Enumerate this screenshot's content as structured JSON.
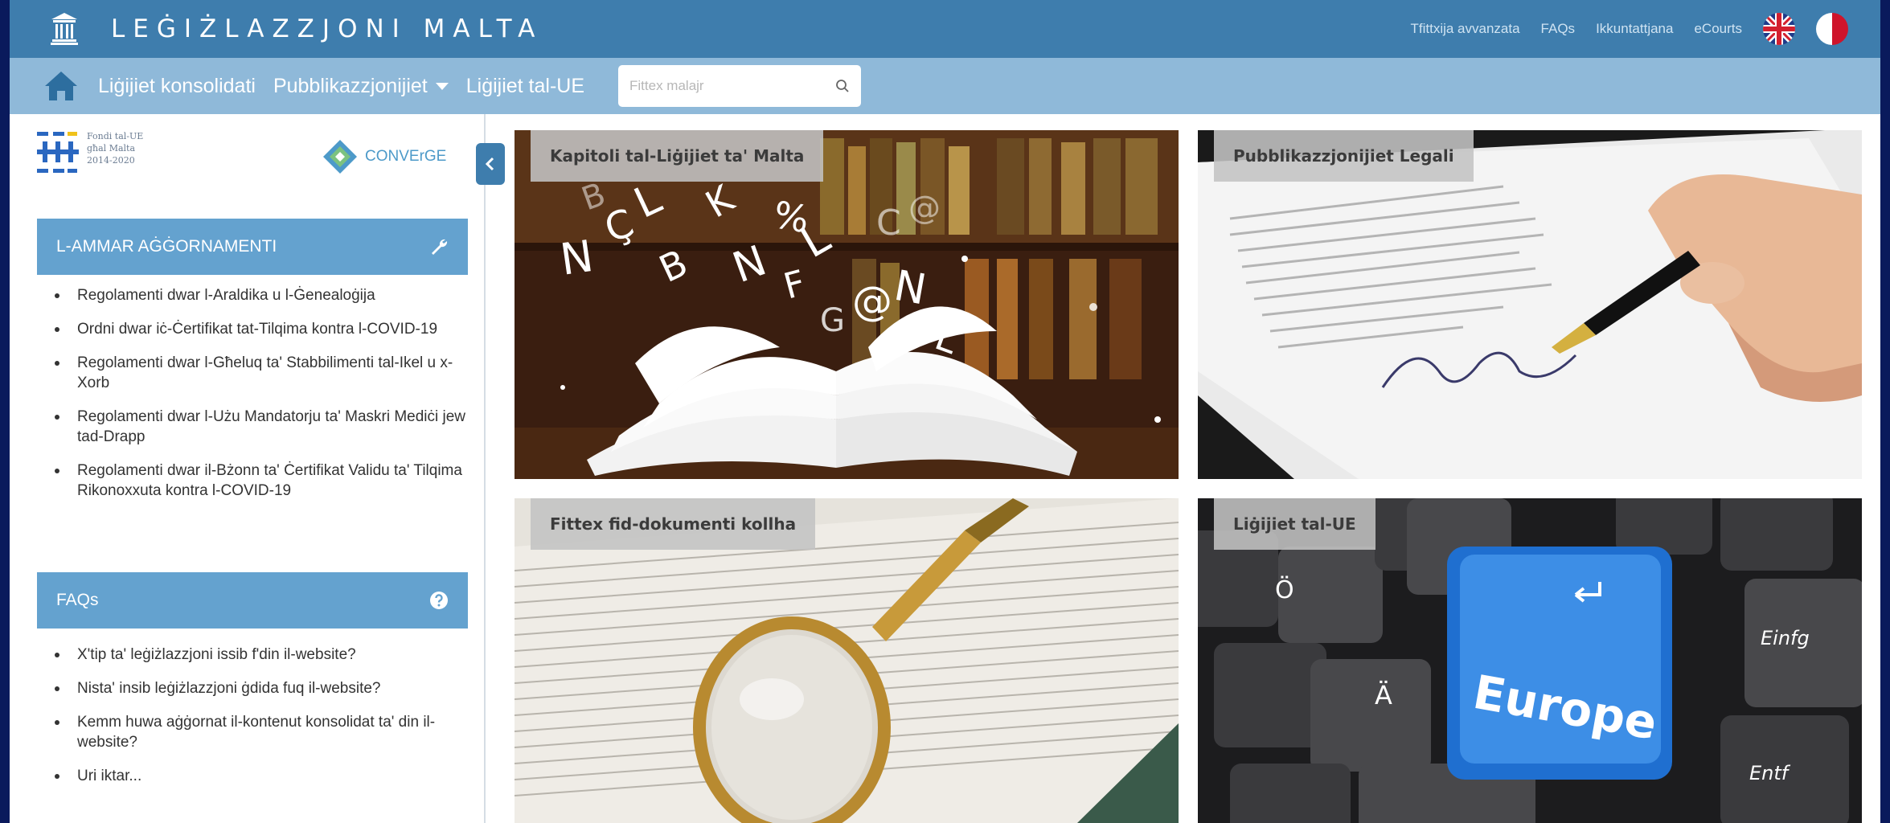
{
  "header": {
    "site_title": "LEĠIŻLAZZJONI MALTA",
    "links": [
      "Tfittxija avvanzata",
      "FAQs",
      "Ikkuntattjana",
      "eCourts"
    ],
    "flags": [
      "uk-flag-icon",
      "malta-flag-icon"
    ]
  },
  "nav": {
    "items": [
      "Liġijiet konsolidati",
      "Pubblikazzjonijiet",
      "Liġijiet tal-UE"
    ],
    "search_placeholder": "Fittex malajr"
  },
  "sidebar": {
    "eu_logo_lines": [
      "Fondi tal-UE",
      "għal Malta",
      "2014-2020"
    ],
    "converge_label": "CONVErGE",
    "updates_title": "L-AMMAR AĠĠORNAMENTI",
    "updates": [
      "Regolamenti dwar l-Araldika u l-Ġenealoġija",
      "Ordni dwar iċ-Ċertifikat tat-Tilqima kontra l-COVID-19",
      "Regolamenti dwar l-Għeluq ta' Stabbilimenti tal-Ikel u x-Xorb",
      "Regolamenti dwar l-Użu Mandatorju ta' Maskri Mediċi jew tad-Drapp",
      "Regolamenti dwar il-Bżonn ta' Ċertifikat Validu ta' Tilqima Rikonoxxuta kontra l-COVID-19"
    ],
    "faq_title": "FAQs",
    "faqs": [
      "X'tip ta' leġiżlazzjoni issib f'din il-website?",
      "Nista' insib leġiżlazzjoni ġdida fuq il-website?",
      "Kemm huwa aġġornat il-kontenut konsolidat ta' din il-website?",
      "Uri iktar..."
    ]
  },
  "tiles": [
    "Kapitoli tal-Liġijiet ta' Malta",
    "Pubblikazzjonijiet Legali",
    "Fittex fid-dokumenti kollha",
    "Liġijiet tal-UE"
  ],
  "tile_images": {
    "keyboard_key_text": "Europe",
    "keyboard_keys": [
      "Ö",
      "Ä",
      "Einfg",
      "Entf"
    ]
  },
  "colors": {
    "top_bar": "#3e7dad",
    "nav_bar": "#8fb9d9",
    "panel_header": "#64a2cf",
    "page_border": "#0a1a5c"
  }
}
